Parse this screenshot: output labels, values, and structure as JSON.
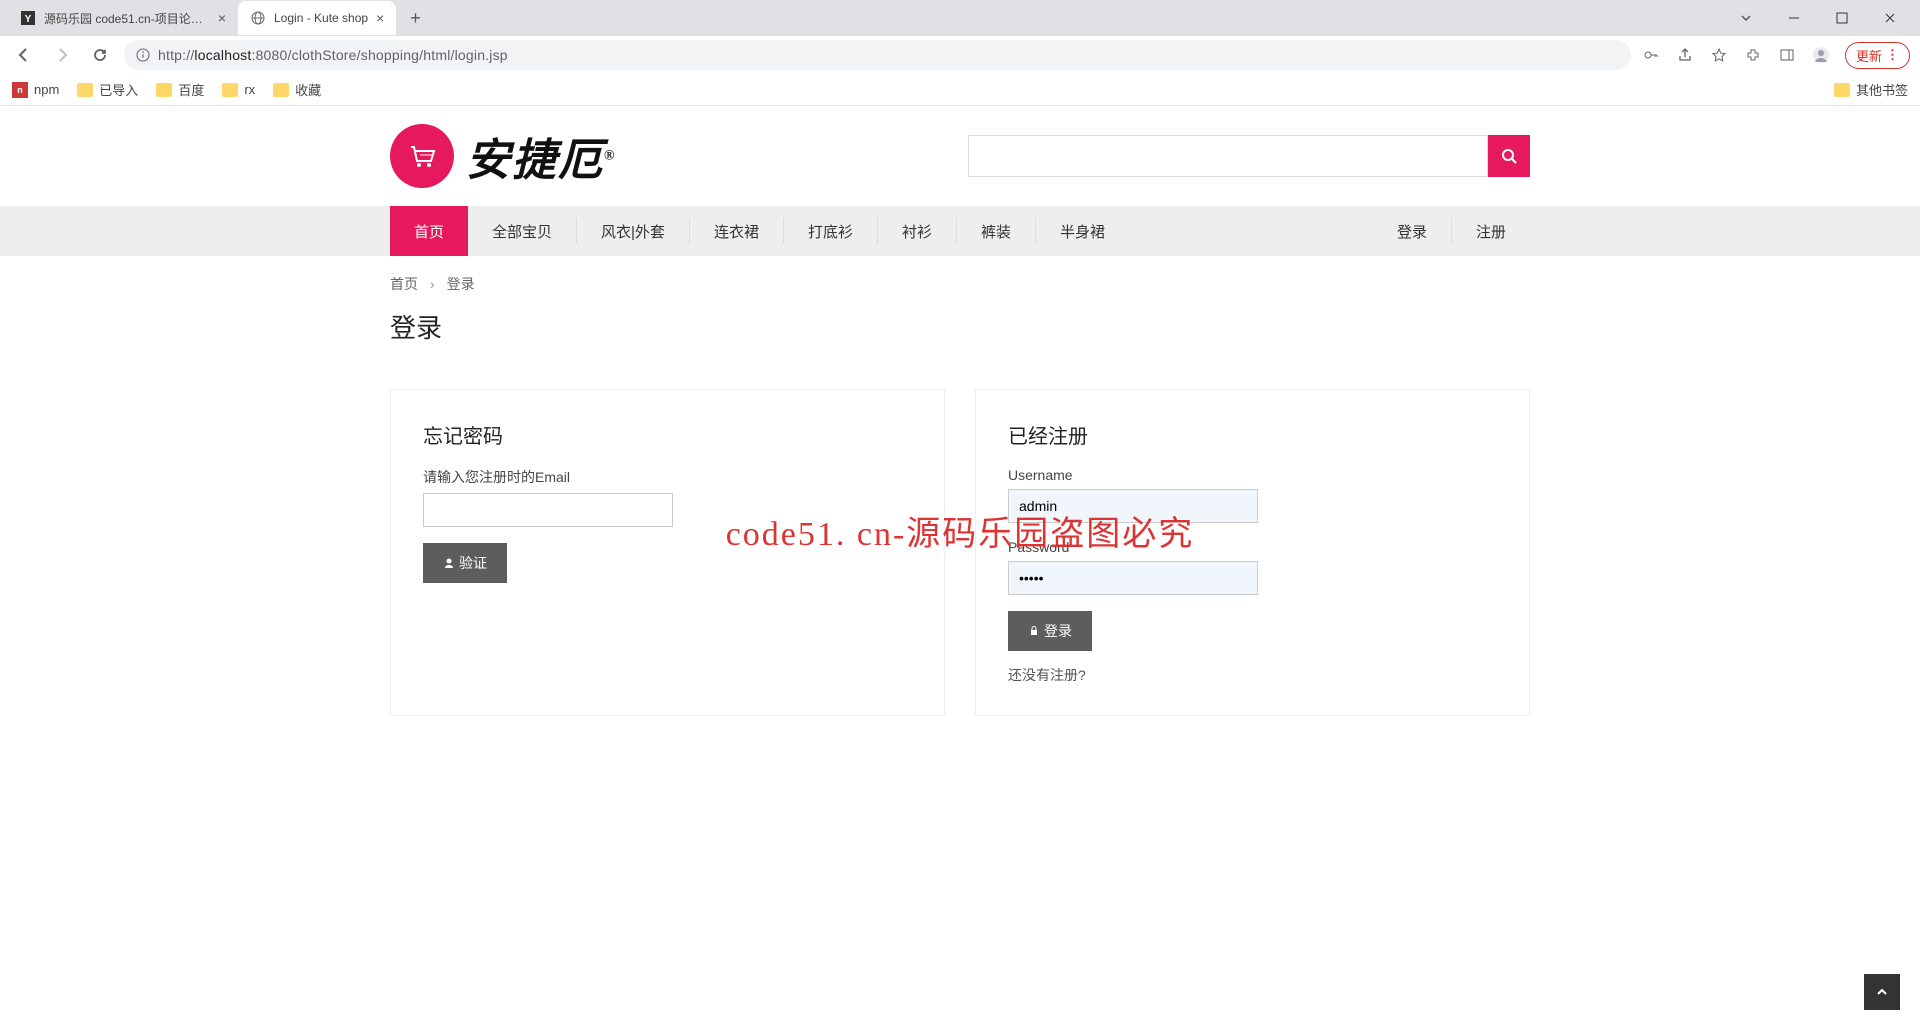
{
  "browser": {
    "tabs": [
      {
        "title": "源码乐园 code51.cn-项目论文代",
        "active": false
      },
      {
        "title": "Login - Kute shop",
        "active": true
      }
    ],
    "url_host": "localhost",
    "url_port": ":8080",
    "url_path": "/clothStore/shopping/html/login.jsp",
    "url_prefix": "http://",
    "update_label": "更新"
  },
  "bookmarks": {
    "items": [
      "npm",
      "已导入",
      "百度",
      "rx",
      "收藏"
    ],
    "other": "其他书签"
  },
  "logo": {
    "brand": "安捷厄",
    "reg": "®"
  },
  "nav": {
    "items": [
      "首页",
      "全部宝贝",
      "风衣|外套",
      "连衣裙",
      "打底衫",
      "衬衫",
      "裤装",
      "半身裙"
    ],
    "right": [
      "登录",
      "注册"
    ]
  },
  "breadcrumb": {
    "home": "首页",
    "sep": "›",
    "current": "登录"
  },
  "title": "登录",
  "forgot": {
    "heading": "忘记密码",
    "label": "请输入您注册时的Email",
    "button": "验证"
  },
  "login": {
    "heading": "已经注册",
    "user_label": "Username",
    "user_value": "admin",
    "pass_label": "Password",
    "pass_value": "•••••",
    "button": "登录",
    "register_link": "还没有注册?"
  },
  "watermark": "code51. cn-源码乐园盗图必究"
}
